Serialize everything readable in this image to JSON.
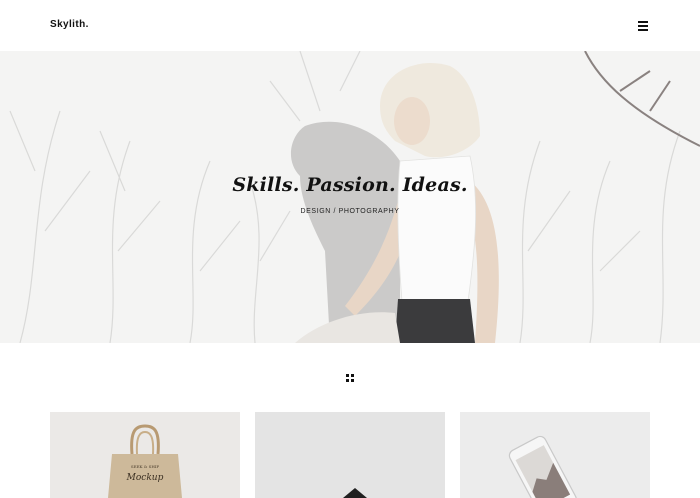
{
  "header": {
    "logo": "Skylith.",
    "menu_icon": "hamburger-menu-icon"
  },
  "hero": {
    "title": "Skills. Passion. Ideas.",
    "subtitle": "DESIGN / PHOTOGRAPHY"
  },
  "filter": {
    "icon": "grid-icon"
  },
  "portfolio": {
    "items": [
      {
        "image": "tote-bag-mockup",
        "bag_text": "Mockup"
      },
      {
        "image": "dark-object-on-grey"
      },
      {
        "image": "smartphone-mockup"
      }
    ]
  },
  "colors": {
    "background": "#ffffff",
    "text": "#111111",
    "hero_bg": "#f3f3f2"
  }
}
